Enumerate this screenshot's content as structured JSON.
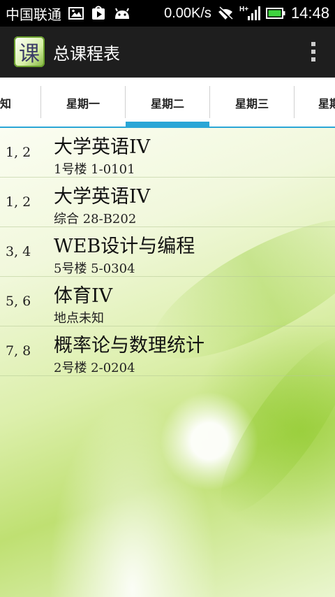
{
  "status_bar": {
    "carrier": "中国联通",
    "speed": "0.00K/s",
    "network": "H+",
    "time": "14:48"
  },
  "app": {
    "icon_char": "课",
    "title": "总课程表"
  },
  "tabs": [
    {
      "label": "未知"
    },
    {
      "label": "星期一"
    },
    {
      "label": "星期二"
    },
    {
      "label": "星期三"
    },
    {
      "label": "星期"
    }
  ],
  "selected_tab": "星期二",
  "courses": [
    {
      "period": "1, 2",
      "name": "大学英语IV",
      "location": "1号楼 1-0101"
    },
    {
      "period": "1, 2",
      "name": "大学英语IV",
      "location": "综合 28-B202"
    },
    {
      "period": "3, 4",
      "name": "WEB设计与编程",
      "location": "5号楼 5-0304"
    },
    {
      "period": "5, 6",
      "name": "体育IV",
      "location": "地点未知"
    },
    {
      "period": "7, 8",
      "name": "概率论与数理统计",
      "location": "2号楼 2-0204"
    }
  ],
  "colors": {
    "tab_indicator": "#2aa6d6",
    "actionbar": "#1e1e1e",
    "battery": "#3fd23f"
  }
}
